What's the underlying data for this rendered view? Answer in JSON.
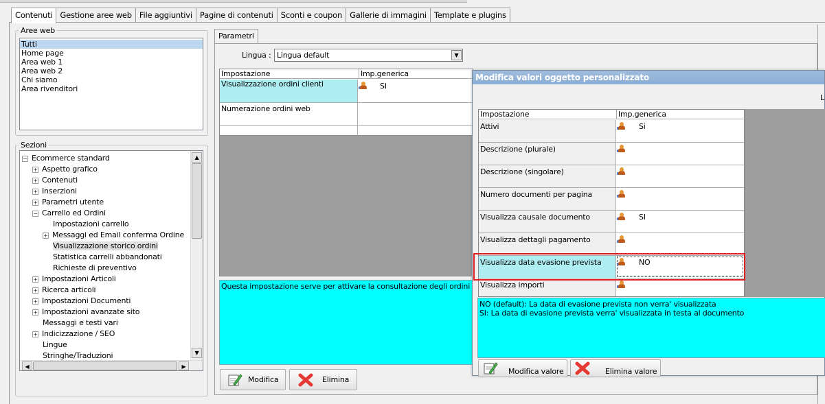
{
  "tabs": [
    "Contenuti",
    "Gestione aree web",
    "File aggiuntivi",
    "Pagine di contenuti",
    "Sconti e coupon",
    "Gallerie di immagini",
    "Template e plugins"
  ],
  "aree_web": {
    "legend": "Aree web",
    "items": [
      "Tutti",
      "Home page",
      "Area web 1",
      "Area web 2",
      "Chi siamo",
      "Area rivenditori"
    ],
    "selected": 0
  },
  "sezioni": {
    "legend": "Sezioni",
    "nodes": [
      {
        "label": "Ecommerce standard",
        "expander": "−"
      },
      {
        "label": "Aspetto grafico",
        "expander": "+"
      },
      {
        "label": "Contenuti",
        "expander": "+"
      },
      {
        "label": "Inserzioni",
        "expander": "+"
      },
      {
        "label": "Parametri utente",
        "expander": "+"
      },
      {
        "label": "Carrello ed Ordini",
        "expander": "−"
      },
      {
        "label": "Impostazioni carrello",
        "expander": ""
      },
      {
        "label": "Messaggi ed Email conferma Ordine",
        "expander": "+"
      },
      {
        "label": "Visualizzazione storico ordini",
        "expander": ""
      },
      {
        "label": "Statistica carrelli abbandonati",
        "expander": ""
      },
      {
        "label": "Richieste di preventivo",
        "expander": ""
      },
      {
        "label": "Impostazioni Articoli",
        "expander": "+"
      },
      {
        "label": "Ricerca articoli",
        "expander": "+"
      },
      {
        "label": "Impostazioni Documenti",
        "expander": "+"
      },
      {
        "label": "Impostazioni avanzate sito",
        "expander": "+"
      },
      {
        "label": "Messaggi e testi vari",
        "expander": ""
      },
      {
        "label": "Indicizzazione / SEO",
        "expander": "+"
      },
      {
        "label": "Lingue",
        "expander": ""
      },
      {
        "label": "Stringhe/Traduzioni",
        "expander": ""
      }
    ]
  },
  "parametri": {
    "tab": "Parametri",
    "lingua_label": "Lingua :",
    "lingua_value": "Lingua default",
    "col_impostazione": "Impostazione",
    "col_impgenerica": "Imp.generica",
    "rows": [
      {
        "name": "Visualizzazione ordini clienti",
        "value": "SI"
      },
      {
        "name": "Numerazione ordini web",
        "value": ""
      }
    ],
    "description": "Questa impostazione serve per attivare la consultazione degli ordini sul pann",
    "btn_modifica": "Modifica",
    "btn_elimina": "Elimina"
  },
  "dialog": {
    "title": "Modifica valori oggetto personalizzato",
    "corner_label": "Li",
    "col_impostazione": "Impostazione",
    "col_impgenerica": "Imp.generica",
    "rows": [
      {
        "name": "Attivi",
        "value": "Si"
      },
      {
        "name": "Descrizione (plurale)",
        "value": ""
      },
      {
        "name": "Descrizione (singolare)",
        "value": ""
      },
      {
        "name": "Numero documenti per pagina",
        "value": ""
      },
      {
        "name": "Visualizza causale documento",
        "value": "SI"
      },
      {
        "name": "Visualizza dettagli pagamento",
        "value": ""
      },
      {
        "name": "Visualizza data evasione prevista",
        "value": "NO"
      },
      {
        "name": "Visualizza importi",
        "value": ""
      }
    ],
    "desc_line1": "NO (default): La data di evasione prevista non verra' visualizzata",
    "desc_line2": "SI: La data di evasione prevista verra' visualizzata in testa al documento",
    "btn_modifica": "Modifica valore",
    "btn_elimina": "Elimina valore"
  }
}
